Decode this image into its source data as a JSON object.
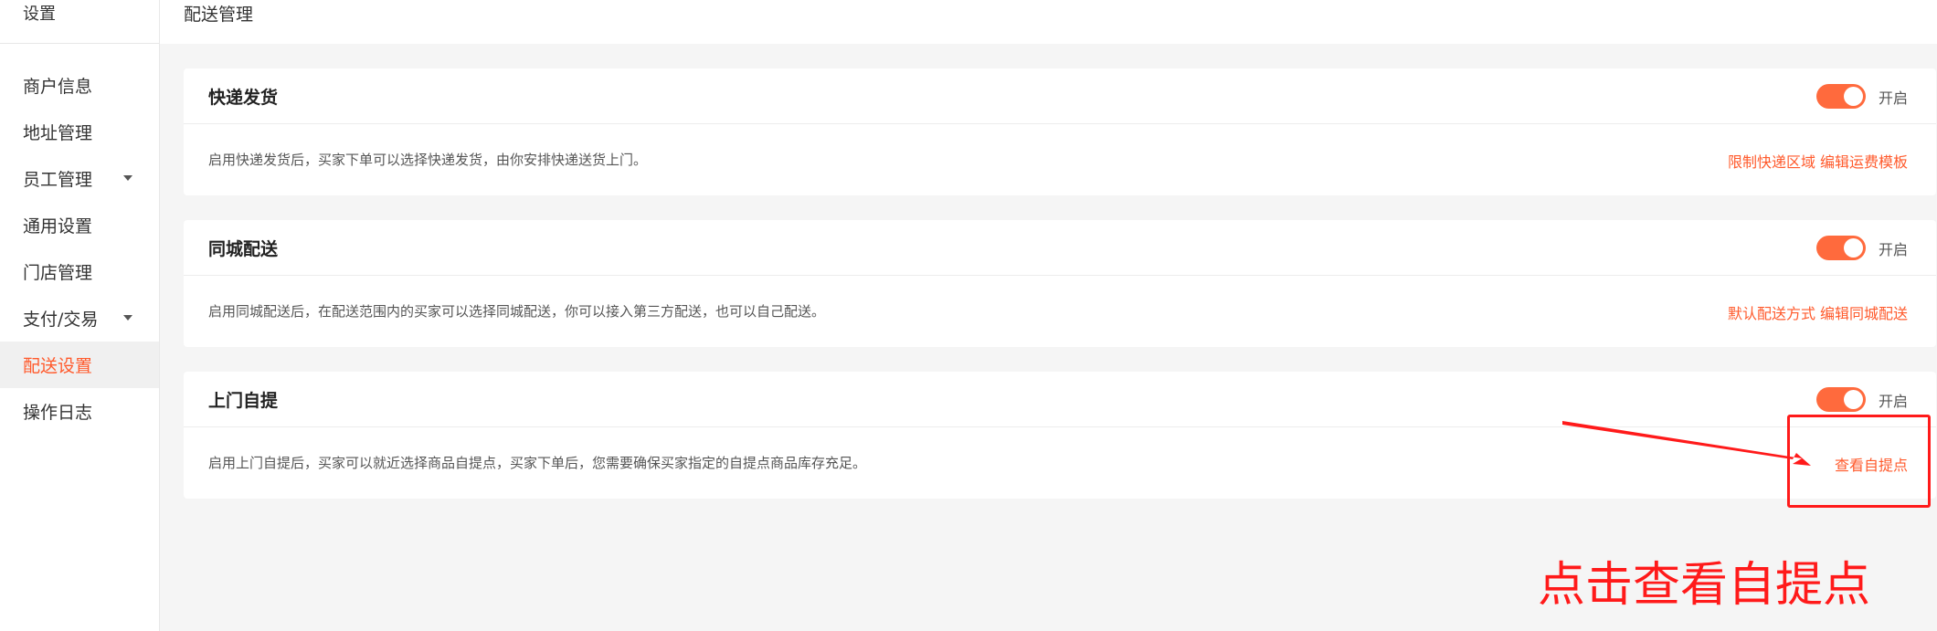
{
  "sidebar": {
    "header": "设置",
    "items": [
      {
        "label": "商户信息",
        "has_caret": false,
        "active": false
      },
      {
        "label": "地址管理",
        "has_caret": false,
        "active": false
      },
      {
        "label": "员工管理",
        "has_caret": true,
        "active": false
      },
      {
        "label": "通用设置",
        "has_caret": false,
        "active": false
      },
      {
        "label": "门店管理",
        "has_caret": false,
        "active": false
      },
      {
        "label": "支付/交易",
        "has_caret": true,
        "active": false
      },
      {
        "label": "配送设置",
        "has_caret": false,
        "active": true
      },
      {
        "label": "操作日志",
        "has_caret": false,
        "active": false
      }
    ]
  },
  "topbar": {
    "title": "配送管理"
  },
  "cards": [
    {
      "title": "快递发货",
      "toggle_label": "开启",
      "toggle_on": true,
      "description": "启用快递发货后，买家下单可以选择快递发货，由你安排快递送货上门。",
      "links": [
        "限制快递区域",
        "编辑运费模板"
      ]
    },
    {
      "title": "同城配送",
      "toggle_label": "开启",
      "toggle_on": true,
      "description": "启用同城配送后，在配送范围内的买家可以选择同城配送，你可以接入第三方配送，也可以自己配送。",
      "links": [
        "默认配送方式",
        "编辑同城配送"
      ]
    },
    {
      "title": "上门自提",
      "toggle_label": "开启",
      "toggle_on": true,
      "description": "启用上门自提后，买家可以就近选择商品自提点，买家下单后，您需要确保买家指定的自提点商品库存充足。",
      "links": [
        "查看自提点"
      ]
    }
  ],
  "annotation": {
    "text": "点击查看自提点"
  },
  "colors": {
    "accent": "#ff5a2c",
    "toggle": "#ff6a3d",
    "annotation": "#ff1a1a"
  }
}
